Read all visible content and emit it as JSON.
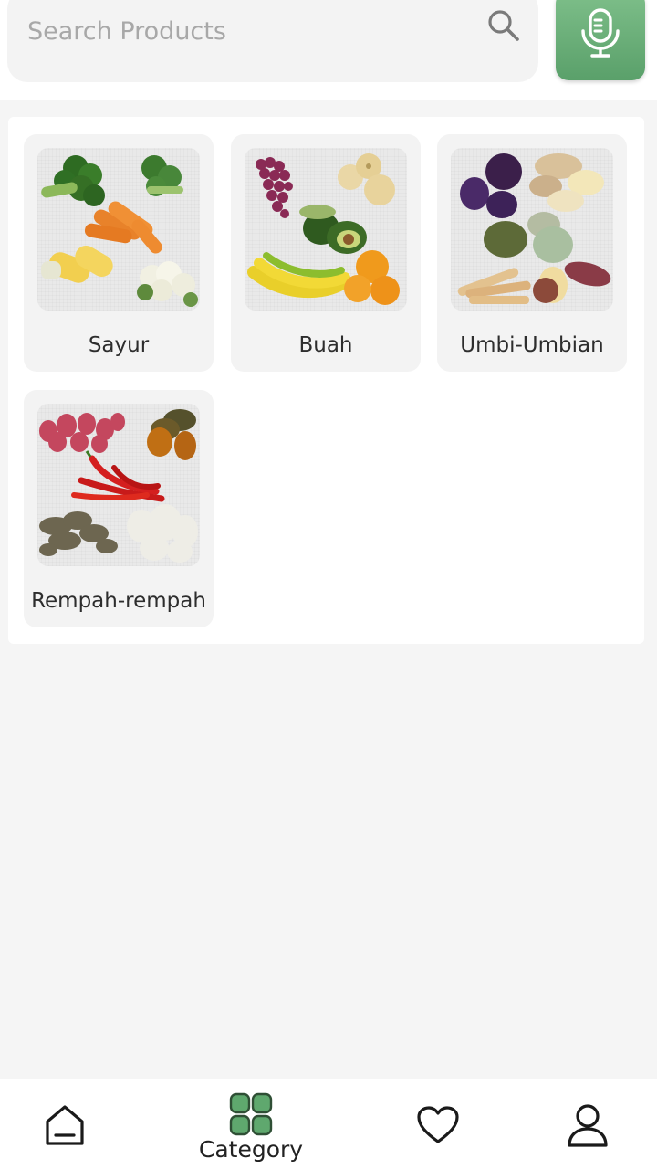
{
  "search": {
    "placeholder": "Search Products",
    "search_icon": "search-icon",
    "voice_icon": "microphone-icon"
  },
  "colors": {
    "accent": "#5fa86e",
    "accent_dark": "#2f6b3c",
    "background": "#f5f5f5",
    "card": "#f3f3f3"
  },
  "categories": [
    {
      "label": "Sayur"
    },
    {
      "label": "Buah"
    },
    {
      "label": "Umbi-Umbian"
    },
    {
      "label": "Rempah-rempah"
    }
  ],
  "bottom_nav": {
    "items": [
      {
        "icon": "home-icon",
        "label": "",
        "active": false
      },
      {
        "icon": "category-grid-icon",
        "label": "Category",
        "active": true
      },
      {
        "icon": "heart-icon",
        "label": "",
        "active": false
      },
      {
        "icon": "user-icon",
        "label": "",
        "active": false
      }
    ]
  }
}
